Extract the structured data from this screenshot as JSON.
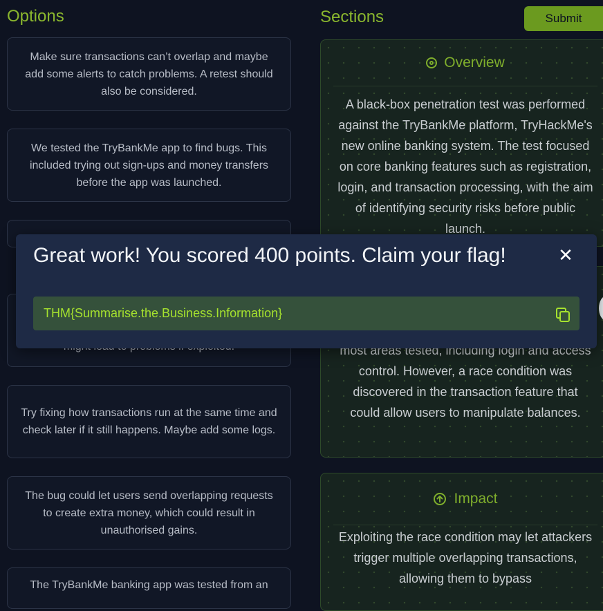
{
  "options": {
    "heading": "Options",
    "cards": [
      "Make sure transactions can’t overlap and maybe add some alerts to catch problems. A retest should also be considered.",
      "We tested the TryBankMe app to find bugs. This included trying out sign-ups and money transfers before the app was launched.",
      "",
      "might lead to problems if exploited.",
      "Try fixing how transactions run at the same time and check later if it still happens. Maybe add some logs.",
      "The bug could let users send overlapping requests to create extra money, which could result in unauthorised gains.",
      "The TryBankMe banking app was tested from an"
    ]
  },
  "sections": {
    "heading": "Sections",
    "submit_label": "Submit",
    "overview": {
      "title": "Overview",
      "body": "A black-box penetration test was performed against the TryBankMe platform, TryHackMe's new online banking system. The test focused on core banking features such as registration, login, and transaction processing, with the aim of identifying security risks before public launch."
    },
    "findings": {
      "body": "most areas tested, including login and access control. However, a race condition was discovered in the transaction feature that could allow users to manipulate balances."
    },
    "impact": {
      "title": "Impact",
      "body": "Exploiting the race condition may let attackers trigger multiple overlapping transactions, allowing them to bypass"
    }
  },
  "modal": {
    "title": "Great work! You scored 400 points. Claim your flag!",
    "close_symbol": "✕",
    "flag": "THM{Summarise.the.Business.Information}"
  },
  "colors": {
    "accent": "#7fae2c",
    "flag_text": "#a6e22e",
    "background": "#0e1321",
    "modal_bg": "#1e2a45"
  }
}
